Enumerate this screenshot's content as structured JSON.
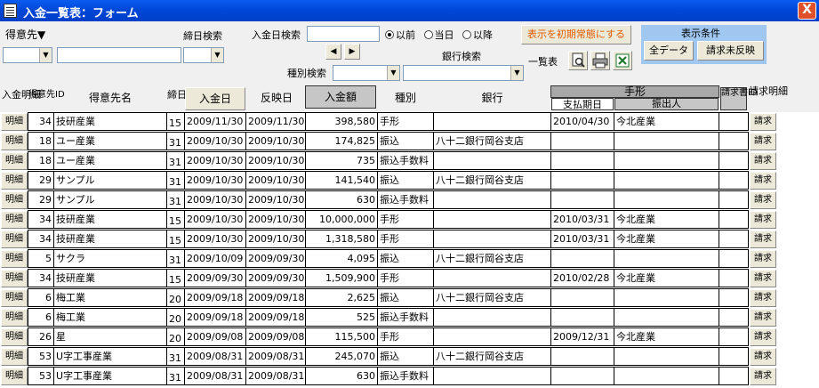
{
  "window": {
    "title": "入金一覧表：フォーム",
    "close_glyph": "X"
  },
  "filters": {
    "customer_label": "得意先▼",
    "closing_day_label": "締日検索",
    "deposit_date_label": "入金日検索",
    "before_label": "以前",
    "same_day_label": "当日",
    "after_label": "以降",
    "reset_button": "表示を初期常態にする",
    "display_cond_label": "表示条件",
    "all_data_button": "全データ",
    "unreflected_button": "請求未反映",
    "type_label": "種別検索",
    "bank_label": "銀行検索",
    "list_label": "一覧表",
    "prev_glyph": "◀",
    "next_glyph": "▶"
  },
  "columns": {
    "detail": "入金明細",
    "cust_id": "得意先ID",
    "cust_name": "得意先名",
    "closing": "締日",
    "deposit_date": "入金日",
    "reflect_date": "反映日",
    "amount": "入金額",
    "type": "種別",
    "bank": "銀行",
    "note": "手形",
    "note_due": "支払期日",
    "note_issuer": "振出人",
    "invoice_id": "請求書ID",
    "invoice_detail": "請求明細"
  },
  "row_button_detail": "明細",
  "row_button_invoice": "請求",
  "rows": [
    {
      "id": "34",
      "name": "技研産業",
      "closing": "15",
      "deposit": "2009/11/30",
      "reflect": "2009/11/30",
      "amount": "398,580",
      "type": "手形",
      "bank": "",
      "due": "2010/04/30",
      "issuer": "今北産業"
    },
    {
      "id": "18",
      "name": "ユー産業",
      "closing": "31",
      "deposit": "2009/10/30",
      "reflect": "2009/10/30",
      "amount": "174,825",
      "type": "振込",
      "bank": "八十二銀行岡谷支店",
      "due": "",
      "issuer": ""
    },
    {
      "id": "18",
      "name": "ユー産業",
      "closing": "31",
      "deposit": "2009/10/30",
      "reflect": "2009/10/30",
      "amount": "735",
      "type": "振込手数料",
      "bank": "",
      "due": "",
      "issuer": ""
    },
    {
      "id": "29",
      "name": "サンプル",
      "closing": "31",
      "deposit": "2009/10/30",
      "reflect": "2009/10/30",
      "amount": "141,540",
      "type": "振込",
      "bank": "八十二銀行岡谷支店",
      "due": "",
      "issuer": ""
    },
    {
      "id": "29",
      "name": "サンプル",
      "closing": "31",
      "deposit": "2009/10/30",
      "reflect": "2009/10/30",
      "amount": "630",
      "type": "振込手数料",
      "bank": "",
      "due": "",
      "issuer": ""
    },
    {
      "id": "34",
      "name": "技研産業",
      "closing": "15",
      "deposit": "2009/10/30",
      "reflect": "2009/10/30",
      "amount": "10,000,000",
      "type": "手形",
      "bank": "",
      "due": "2010/03/31",
      "issuer": "今北産業"
    },
    {
      "id": "34",
      "name": "技研産業",
      "closing": "15",
      "deposit": "2009/10/30",
      "reflect": "2009/10/30",
      "amount": "1,318,580",
      "type": "手形",
      "bank": "",
      "due": "2010/03/31",
      "issuer": "今北産業"
    },
    {
      "id": "5",
      "name": "サクラ",
      "closing": "31",
      "deposit": "2009/10/09",
      "reflect": "2009/09/30",
      "amount": "4,095",
      "type": "振込",
      "bank": "八十二銀行岡谷支店",
      "due": "",
      "issuer": ""
    },
    {
      "id": "34",
      "name": "技研産業",
      "closing": "15",
      "deposit": "2009/09/30",
      "reflect": "2009/09/30",
      "amount": "1,509,900",
      "type": "手形",
      "bank": "",
      "due": "2010/02/28",
      "issuer": "今北産業"
    },
    {
      "id": "6",
      "name": "梅工業",
      "closing": "20",
      "deposit": "2009/09/18",
      "reflect": "2009/09/18",
      "amount": "2,625",
      "type": "振込",
      "bank": "八十二銀行岡谷支店",
      "due": "",
      "issuer": ""
    },
    {
      "id": "6",
      "name": "梅工業",
      "closing": "20",
      "deposit": "2009/09/18",
      "reflect": "2009/09/18",
      "amount": "525",
      "type": "振込手数料",
      "bank": "",
      "due": "",
      "issuer": ""
    },
    {
      "id": "26",
      "name": "星",
      "closing": "20",
      "deposit": "2009/09/08",
      "reflect": "2009/09/08",
      "amount": "115,500",
      "type": "手形",
      "bank": "",
      "due": "2009/12/31",
      "issuer": "今北産業"
    },
    {
      "id": "53",
      "name": "U字工事産業",
      "closing": "31",
      "deposit": "2009/08/31",
      "reflect": "2009/08/31",
      "amount": "245,070",
      "type": "振込",
      "bank": "八十二銀行岡谷支店",
      "due": "",
      "issuer": ""
    },
    {
      "id": "53",
      "name": "U字工事産業",
      "closing": "31",
      "deposit": "2009/08/31",
      "reflect": "2009/08/31",
      "amount": "630",
      "type": "振込手数料",
      "bank": "",
      "due": "",
      "issuer": ""
    }
  ]
}
